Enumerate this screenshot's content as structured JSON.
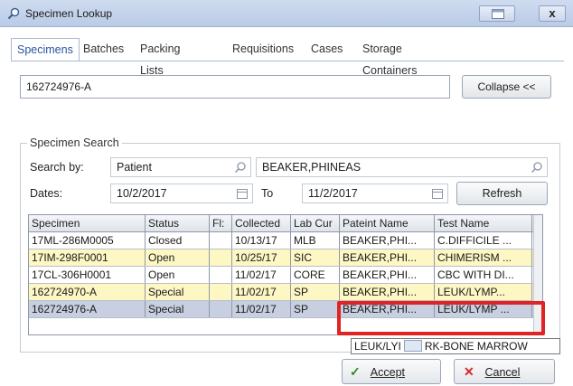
{
  "window": {
    "title": "Specimen Lookup",
    "close_label": "x"
  },
  "tabs": [
    {
      "label": "Specimens",
      "active": true
    },
    {
      "label": "Batches"
    },
    {
      "label": "Packing Lists"
    },
    {
      "label": "Requisitions"
    },
    {
      "label": "Cases"
    },
    {
      "label": "Storage Containers"
    }
  ],
  "lookup": {
    "value": "162724976-A",
    "collapse_label": "Collapse <<"
  },
  "search": {
    "legend": "Specimen Search",
    "search_by_label": "Search by:",
    "search_by_value": "Patient",
    "patient_value": "BEAKER,PHINEAS",
    "dates_label": "Dates:",
    "date_from": "10/2/2017",
    "to_label": "To",
    "date_to": "11/2/2017",
    "refresh_label": "Refresh"
  },
  "grid": {
    "columns": [
      "Specimen",
      "Status",
      "Fl:",
      "Collected",
      "Lab Cur",
      "Pateint Name",
      "Test Name"
    ],
    "rows": [
      [
        "17ML-286M0005",
        "Closed",
        "",
        "10/13/17",
        "MLB",
        "BEAKER,PHI...",
        "C.DIFFICILE ..."
      ],
      [
        "17IM-298F0001",
        "Open",
        "",
        "10/25/17",
        "SIC",
        "BEAKER,PHI...",
        "CHIMERISM ..."
      ],
      [
        "17CL-306H0001",
        "Open",
        "",
        "11/02/17",
        "CORE",
        "BEAKER,PHI...",
        "CBC WITH DI..."
      ],
      [
        "162724970-A",
        "Special",
        "",
        "11/02/17",
        "SP",
        "BEAKER,PHI...",
        "LEUK/LYMP..."
      ],
      [
        "162724976-A",
        "Special",
        "",
        "11/02/17",
        "SP",
        "BEAKER,PHI...",
        "LEUK/LYMP ..."
      ]
    ]
  },
  "tooltip": {
    "left_text": "LEUK/LYI",
    "right_text": "RK-BONE MARROW"
  },
  "footer": {
    "accept_label": "Accept",
    "cancel_label": "Cancel"
  }
}
